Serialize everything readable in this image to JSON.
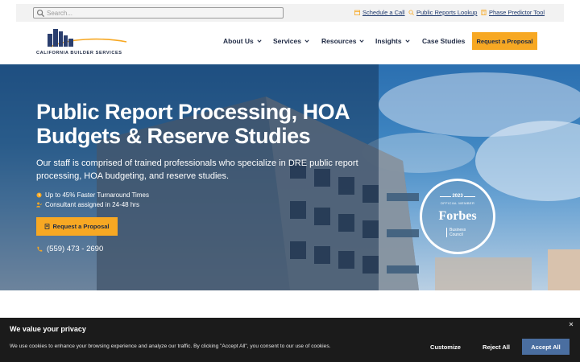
{
  "search": {
    "placeholder": "Search..."
  },
  "utility_links": [
    {
      "label": "Schedule a Call",
      "icon": "calendar-icon"
    },
    {
      "label": "Public Reports Lookup",
      "icon": "search-doc-icon"
    },
    {
      "label": "Phase Predictor Tool",
      "icon": "calculator-icon"
    }
  ],
  "logo": {
    "text": "California Builder Services"
  },
  "nav": {
    "items": [
      {
        "label": "About Us",
        "dropdown": true
      },
      {
        "label": "Services",
        "dropdown": true
      },
      {
        "label": "Resources",
        "dropdown": true
      },
      {
        "label": "Insights",
        "dropdown": true
      },
      {
        "label": "Case Studies",
        "dropdown": false
      }
    ],
    "cta_label": "Request a Proposal"
  },
  "hero": {
    "title": "Public Report Processing, HOA Budgets & Reserve Studies",
    "subtitle": "Our staff is comprised of trained professionals who specialize in DRE public report processing, HOA budgeting, and reserve studies.",
    "features": [
      {
        "text": "Up to 45% Faster Turnaround Times",
        "icon": "clock-icon"
      },
      {
        "text": "Consultant assigned in 24-48 hrs",
        "icon": "user-check-icon"
      }
    ],
    "cta_label": "Request a Proposal",
    "phone": "(559) 473 - 2690"
  },
  "badge": {
    "year": "2023",
    "member": "OFFICIAL MEMBER",
    "brand": "Forbes",
    "council_line1": "Business",
    "council_line2": "Council"
  },
  "cookie": {
    "title": "We value your privacy",
    "text": "We use cookies to enhance your browsing experience and analyze our traffic. By clicking \"Accept All\", you consent to our use of cookies.",
    "customize_label": "Customize",
    "reject_label": "Reject All",
    "accept_label": "Accept All"
  },
  "colors": {
    "accent": "#f7a823",
    "navy": "#1f2a44",
    "link": "#1f3a6e",
    "cookie_bg": "#1b1b1b",
    "accept_btn": "#4a6ea0"
  }
}
